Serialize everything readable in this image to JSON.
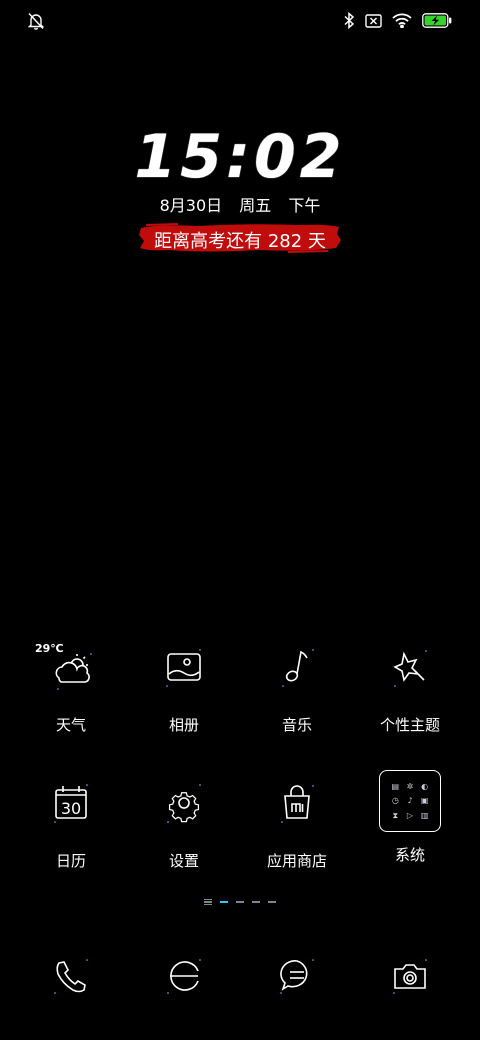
{
  "status_bar": {
    "left_icons": [
      "bell-off-icon"
    ],
    "right_icons": [
      "bluetooth-icon",
      "no-sim-icon",
      "wifi-icon",
      "battery-charging-icon"
    ],
    "battery_color": "#35d32c"
  },
  "lockscreen": {
    "time": "15:02",
    "date": "8月30日",
    "weekday": "周五",
    "period": "下午",
    "countdown": "距离高考还有 282 天",
    "countdown_color": "#c10c0c"
  },
  "apps": [
    {
      "label": "天气",
      "icon": "weather-icon",
      "temp": "29℃"
    },
    {
      "label": "相册",
      "icon": "gallery-icon"
    },
    {
      "label": "音乐",
      "icon": "music-icon"
    },
    {
      "label": "个性主题",
      "icon": "themes-icon"
    },
    {
      "label": "日历",
      "icon": "calendar-icon",
      "day": "30"
    },
    {
      "label": "设置",
      "icon": "settings-icon"
    },
    {
      "label": "应用商店",
      "icon": "app-store-icon"
    },
    {
      "label": "系统",
      "icon": "folder-icon"
    }
  ],
  "page_indicator": {
    "count": 4,
    "active": 0
  },
  "dock": [
    {
      "icon": "phone-icon"
    },
    {
      "icon": "browser-icon"
    },
    {
      "icon": "messages-icon"
    },
    {
      "icon": "camera-icon"
    }
  ]
}
